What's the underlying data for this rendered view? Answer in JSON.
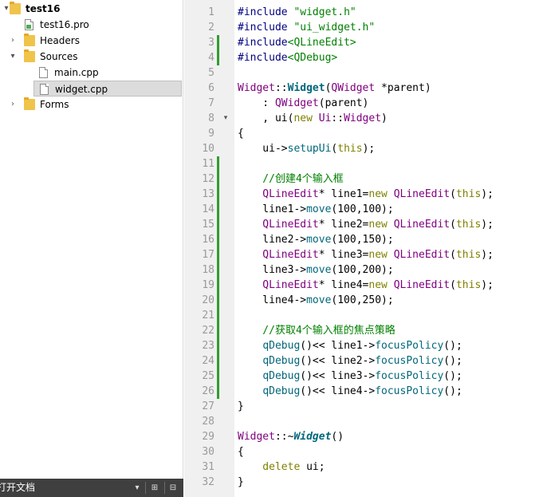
{
  "tree": {
    "items": [
      {
        "label": "test16",
        "icon": "project-folder-icon",
        "arrow": "▾",
        "level": 0,
        "bold": true
      },
      {
        "label": "test16.pro",
        "icon": "pro-file-icon",
        "arrow": "",
        "level": 1
      },
      {
        "label": "Headers",
        "icon": "headers-folder-icon",
        "arrow": "›",
        "level": 1
      },
      {
        "label": "Sources",
        "icon": "sources-folder-icon",
        "arrow": "▾",
        "level": 1
      },
      {
        "label": "main.cpp",
        "icon": "cpp-file-icon",
        "arrow": "",
        "level": 2
      },
      {
        "label": "widget.cpp",
        "icon": "cpp-file-icon",
        "arrow": "",
        "level": 2,
        "selected": true
      },
      {
        "label": "Forms",
        "icon": "forms-folder-icon",
        "arrow": "›",
        "level": 1
      }
    ]
  },
  "tree_bar": {
    "label": "打开文档",
    "dropdown": "▾",
    "split_button": "⊞",
    "close_button": "⊟"
  },
  "editor": {
    "lines": [
      {
        "n": "1",
        "t": [
          [
            "pp",
            "#include "
          ],
          [
            "str",
            "\"widget.h\""
          ]
        ]
      },
      {
        "n": "2",
        "t": [
          [
            "pp",
            "#include "
          ],
          [
            "str",
            "\"ui_widget.h\""
          ]
        ]
      },
      {
        "n": "3",
        "t": [
          [
            "pp",
            "#include"
          ],
          [
            "str",
            "<QLineEdit>"
          ]
        ]
      },
      {
        "n": "4",
        "t": [
          [
            "pp",
            "#include"
          ],
          [
            "str",
            "<QDebug>"
          ]
        ]
      },
      {
        "n": "5",
        "t": []
      },
      {
        "n": "6",
        "t": [
          [
            "ty",
            "Widget"
          ],
          [
            "op",
            "::"
          ],
          [
            "bf",
            "Widget"
          ],
          [
            "op",
            "("
          ],
          [
            "ty",
            "QWidget"
          ],
          [
            "op",
            " *parent)"
          ]
        ]
      },
      {
        "n": "7",
        "t": [
          [
            "op",
            "    : "
          ],
          [
            "ty",
            "QWidget"
          ],
          [
            "op",
            "(parent)"
          ]
        ]
      },
      {
        "n": "8",
        "t": [
          [
            "op",
            "    , ui("
          ],
          [
            "kw",
            "new "
          ],
          [
            "ty",
            "Ui"
          ],
          [
            "op",
            "::"
          ],
          [
            "ty",
            "Widget"
          ],
          [
            "op",
            ")"
          ]
        ]
      },
      {
        "n": "9",
        "t": [
          [
            "op",
            "{"
          ]
        ]
      },
      {
        "n": "10",
        "t": [
          [
            "op",
            "    ui->"
          ],
          [
            "fn",
            "setupUi"
          ],
          [
            "op",
            "("
          ],
          [
            "kw",
            "this"
          ],
          [
            "op",
            ");"
          ]
        ]
      },
      {
        "n": "11",
        "t": []
      },
      {
        "n": "12",
        "t": [
          [
            "cm",
            "    //创建4个输入框"
          ]
        ]
      },
      {
        "n": "13",
        "t": [
          [
            "ty",
            "    QLineEdit"
          ],
          [
            "op",
            "* line1="
          ],
          [
            "kw",
            "new "
          ],
          [
            "ty",
            "QLineEdit"
          ],
          [
            "op",
            "("
          ],
          [
            "kw",
            "this"
          ],
          [
            "op",
            ");"
          ]
        ]
      },
      {
        "n": "14",
        "t": [
          [
            "op",
            "    line1->"
          ],
          [
            "fn",
            "move"
          ],
          [
            "op",
            "(100,100);"
          ]
        ]
      },
      {
        "n": "15",
        "t": [
          [
            "ty",
            "    QLineEdit"
          ],
          [
            "op",
            "* line2="
          ],
          [
            "kw",
            "new "
          ],
          [
            "ty",
            "QLineEdit"
          ],
          [
            "op",
            "("
          ],
          [
            "kw",
            "this"
          ],
          [
            "op",
            ");"
          ]
        ]
      },
      {
        "n": "16",
        "t": [
          [
            "op",
            "    line2->"
          ],
          [
            "fn",
            "move"
          ],
          [
            "op",
            "(100,150);"
          ]
        ]
      },
      {
        "n": "17",
        "t": [
          [
            "ty",
            "    QLineEdit"
          ],
          [
            "op",
            "* line3="
          ],
          [
            "kw",
            "new "
          ],
          [
            "ty",
            "QLineEdit"
          ],
          [
            "op",
            "("
          ],
          [
            "kw",
            "this"
          ],
          [
            "op",
            ");"
          ]
        ]
      },
      {
        "n": "18",
        "t": [
          [
            "op",
            "    line3->"
          ],
          [
            "fn",
            "move"
          ],
          [
            "op",
            "(100,200);"
          ]
        ]
      },
      {
        "n": "19",
        "t": [
          [
            "ty",
            "    QLineEdit"
          ],
          [
            "op",
            "* line4="
          ],
          [
            "kw",
            "new "
          ],
          [
            "ty",
            "QLineEdit"
          ],
          [
            "op",
            "("
          ],
          [
            "kw",
            "this"
          ],
          [
            "op",
            ");"
          ]
        ]
      },
      {
        "n": "20",
        "t": [
          [
            "op",
            "    line4->"
          ],
          [
            "fn",
            "move"
          ],
          [
            "op",
            "(100,250);"
          ]
        ]
      },
      {
        "n": "21",
        "t": []
      },
      {
        "n": "22",
        "t": [
          [
            "cm",
            "    //获取4个输入框的焦点策略"
          ]
        ]
      },
      {
        "n": "23",
        "t": [
          [
            "op",
            "    "
          ],
          [
            "fn",
            "qDebug"
          ],
          [
            "op",
            "()<< line1->"
          ],
          [
            "fn",
            "focusPolicy"
          ],
          [
            "op",
            "();"
          ]
        ]
      },
      {
        "n": "24",
        "t": [
          [
            "op",
            "    "
          ],
          [
            "fn",
            "qDebug"
          ],
          [
            "op",
            "()<< line2->"
          ],
          [
            "fn",
            "focusPolicy"
          ],
          [
            "op",
            "();"
          ]
        ]
      },
      {
        "n": "25",
        "t": [
          [
            "op",
            "    "
          ],
          [
            "fn",
            "qDebug"
          ],
          [
            "op",
            "()<< line3->"
          ],
          [
            "fn",
            "focusPolicy"
          ],
          [
            "op",
            "();"
          ]
        ]
      },
      {
        "n": "26",
        "t": [
          [
            "op",
            "    "
          ],
          [
            "fn",
            "qDebug"
          ],
          [
            "op",
            "()<< line4->"
          ],
          [
            "fn",
            "focusPolicy"
          ],
          [
            "op",
            "();"
          ]
        ]
      },
      {
        "n": "27",
        "t": [
          [
            "op",
            "}"
          ]
        ]
      },
      {
        "n": "28",
        "t": []
      },
      {
        "n": "29",
        "t": [
          [
            "ty",
            "Widget"
          ],
          [
            "op",
            "::~"
          ],
          [
            "bfi",
            "Widget"
          ],
          [
            "op",
            "()"
          ]
        ]
      },
      {
        "n": "30",
        "t": [
          [
            "op",
            "{"
          ]
        ]
      },
      {
        "n": "31",
        "t": [
          [
            "kw",
            "    delete "
          ],
          [
            "op",
            "ui;"
          ]
        ]
      },
      {
        "n": "32",
        "t": [
          [
            "op",
            "}"
          ]
        ]
      }
    ],
    "modified_ranges": [
      [
        3,
        4
      ],
      [
        11,
        26
      ]
    ],
    "fold_markers": [
      {
        "line": 8,
        "glyph": "▾"
      }
    ]
  },
  "colors": {
    "preprocessor": "#000080",
    "string": "#008000",
    "type": "#800080",
    "function": "#00677c",
    "keyword": "#808000",
    "comment": "#008000",
    "modified_bar": "#2f9e2f",
    "gutter_bg": "#f0f0f0",
    "tree_bar_bg": "#3f3f3f"
  }
}
